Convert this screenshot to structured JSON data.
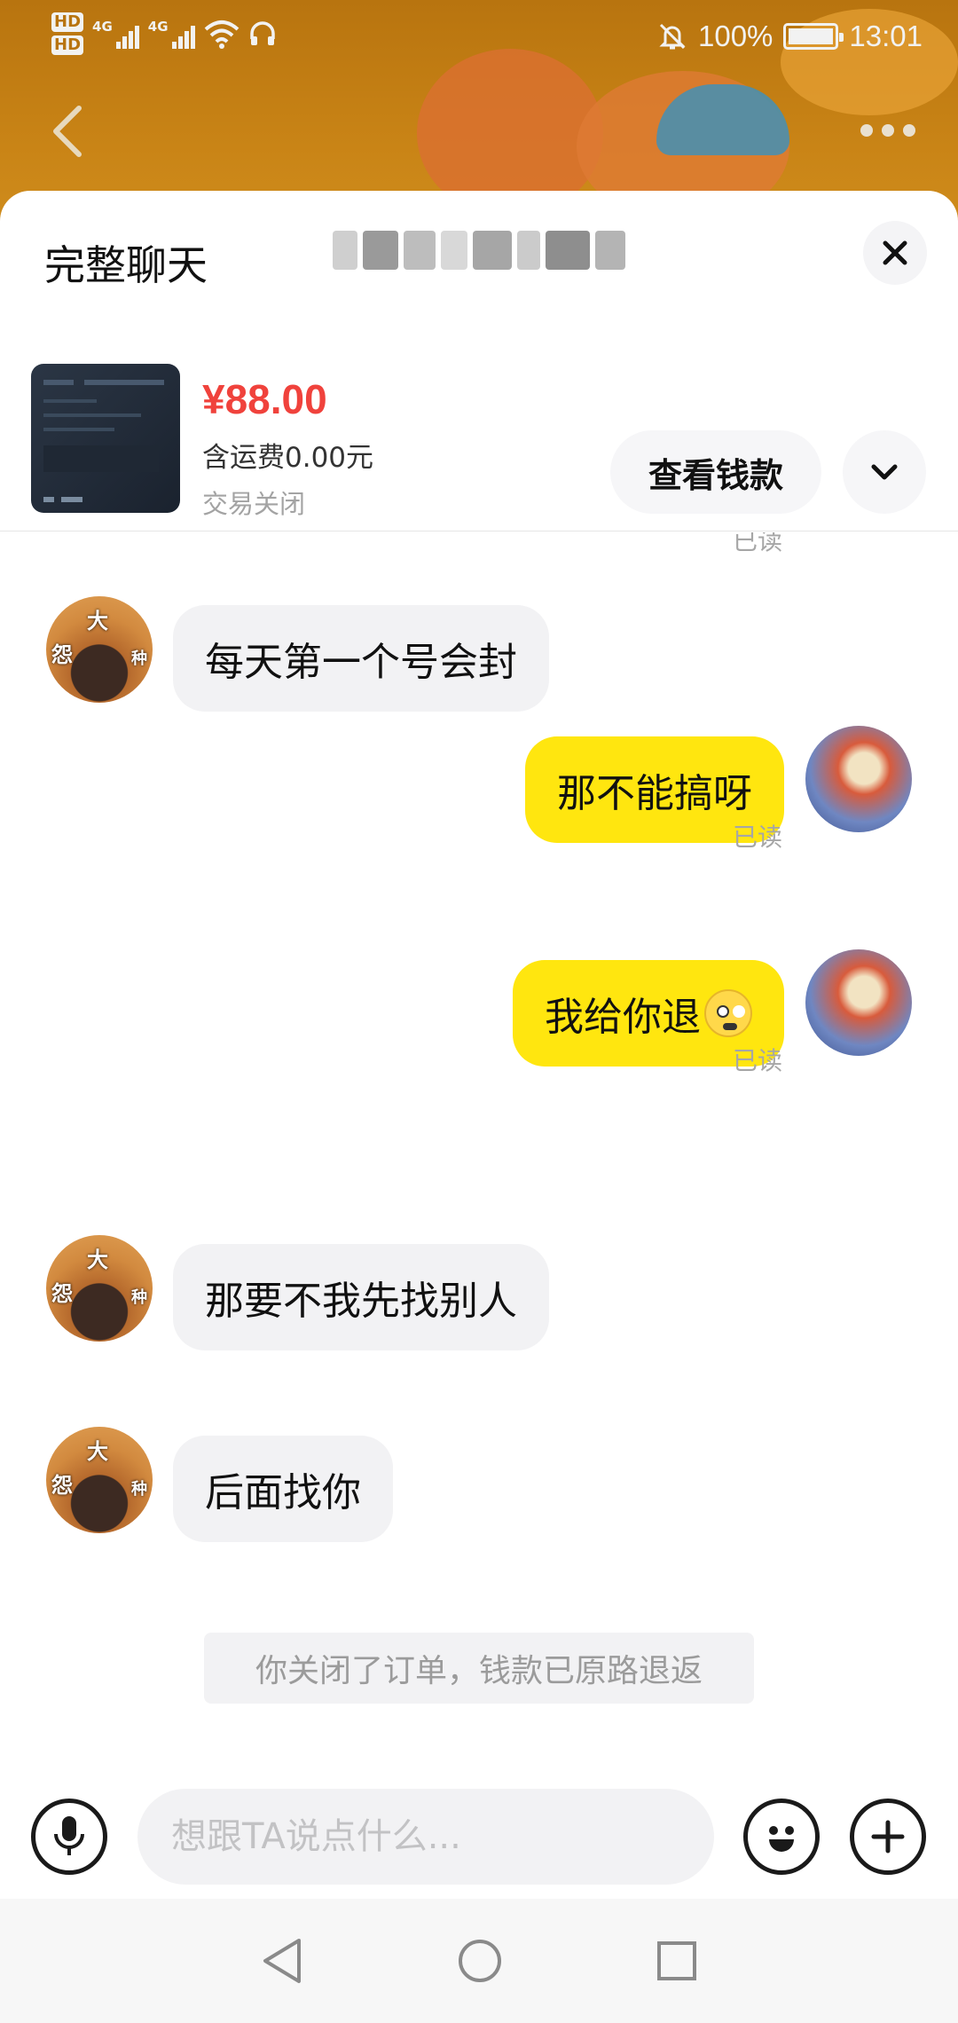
{
  "status_bar": {
    "hd1": "HD",
    "hd2": "HD",
    "net1": "4G",
    "net2": "4G",
    "battery_percent": "100%",
    "time": "13:01"
  },
  "header": {
    "back_icon": "back-arrow-icon",
    "more_icon": "more-dots-icon"
  },
  "sheet": {
    "title": "完整聊天",
    "close_icon": "close-icon"
  },
  "product": {
    "price": "¥88.00",
    "shipping": "含运费0.00元",
    "status": "交易关闭",
    "view_button": "查看钱款",
    "expand_icon": "chevron-down-icon"
  },
  "chat": {
    "top_read": "已读",
    "messages": [
      {
        "from": "them",
        "text": "每天第一个号会封"
      },
      {
        "from": "me",
        "text": "那不能搞呀",
        "status": "已读"
      },
      {
        "from": "me",
        "text": "我给你退",
        "emoji": "nervous-sweat-emoji",
        "status": "已读"
      },
      {
        "from": "them",
        "text": "那要不我先找别人"
      },
      {
        "from": "them",
        "text": "后面找你"
      }
    ],
    "avatar_text": [
      "大",
      "怨",
      "种"
    ],
    "system_note": "你关闭了订单，钱款已原路退返"
  },
  "input_bar": {
    "voice_icon": "microphone-icon",
    "placeholder": "想跟TA说点什么...",
    "emoji_icon": "emoji-icon",
    "plus_icon": "plus-icon"
  },
  "nav_bar": {
    "icons": [
      "nav-back-icon",
      "nav-home-icon",
      "nav-recents-icon"
    ]
  },
  "colors": {
    "accent_yellow": "#ffe60f",
    "price_red": "#f0423c",
    "header_bg": "#c98416"
  }
}
